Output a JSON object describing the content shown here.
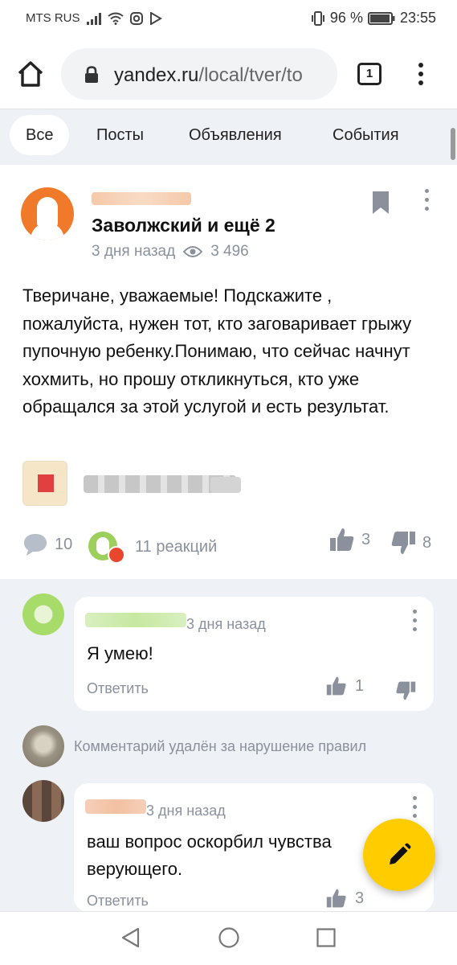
{
  "status_bar": {
    "carrier": "MTS RUS",
    "battery": "96 %",
    "time": "23:55"
  },
  "browser": {
    "url_host": "yandex.ru",
    "url_path": "/local/tver/to",
    "tab_count": "1"
  },
  "tabs": [
    {
      "label": "Все",
      "active": true
    },
    {
      "label": "Посты",
      "active": false
    },
    {
      "label": "Объявления",
      "active": false
    },
    {
      "label": "События",
      "active": false
    }
  ],
  "post": {
    "location": "Заволжский и ещё 2",
    "time_ago": "3 дня назад",
    "views": "3 496",
    "text": "Тверичане, уважаемые! Подскажите , пожалуйста, нужен тот, кто заговаривает грыжу пупочную ребенку.Понимаю, что сейчас начнут хохмить, но прошу откликнуться, кто уже обращался за этой услугой и есть результат.",
    "comments_count": "10",
    "reactions": "11 реакций",
    "likes": "3",
    "dislikes": "8"
  },
  "comments": [
    {
      "time_ago": "3 дня назад",
      "text": "Я умею!",
      "reply_label": "Ответить",
      "likes": "1"
    },
    {
      "deleted_text": "Комментарий удалён за нарушение правил"
    },
    {
      "time_ago": "3 дня назад",
      "text": "ваш вопрос оскорбил чувства верующего.",
      "reply_label": "Ответить",
      "likes": "3"
    }
  ],
  "colors": {
    "accent_fab": "#ffcc00",
    "avatar_orange": "#f07a2a",
    "muted_text": "#8a919c",
    "page_bg": "#eef1f5"
  },
  "icons": [
    "home-icon",
    "lock-icon",
    "tab-switcher-icon",
    "menu-icon",
    "bookmark-icon",
    "eye-icon",
    "comment-icon",
    "like-icon",
    "dislike-icon",
    "pencil-icon",
    "back-nav-icon",
    "home-nav-icon",
    "recents-nav-icon"
  ]
}
